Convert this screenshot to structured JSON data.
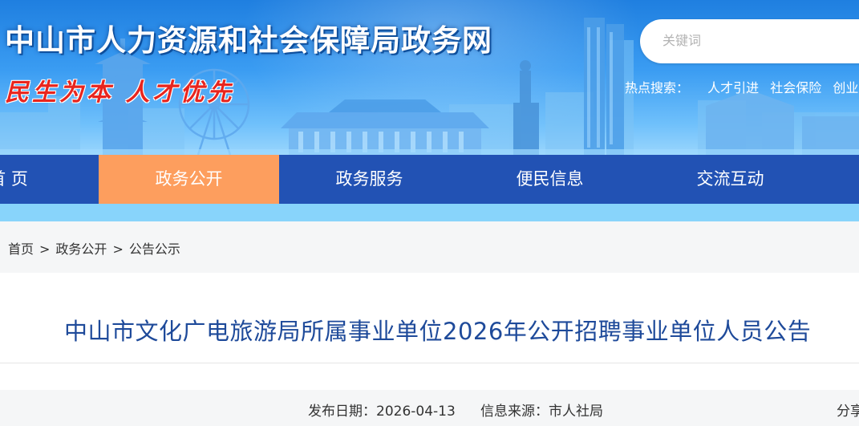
{
  "header": {
    "site_title": "中山市人力资源和社会保障局政务网",
    "slogan": "民生为本 人才优先",
    "search_placeholder": "关键词",
    "hot_label": "热点搜索：",
    "hot_links": [
      "人才引进",
      "社会保险",
      "创业"
    ]
  },
  "nav": {
    "items": [
      "首 页",
      "政务公开",
      "政务服务",
      "便民信息",
      "交流互动"
    ],
    "active_index": 1
  },
  "breadcrumb": [
    "首页",
    "政务公开",
    "公告公示"
  ],
  "breadcrumb_separator": ">",
  "article": {
    "title": "中山市文化广电旅游局所属事业单位2026年公开招聘事业单位人员公告",
    "publish_date_label": "发布日期：",
    "publish_date": "2026-04-13",
    "source_label": "信息来源：",
    "source": "市人社局",
    "share_label": "分享"
  },
  "colors": {
    "nav_bg": "#2252b4",
    "nav_active": "#fd9e5e",
    "title_blue": "#1e4a9a",
    "slogan_red": "#e8251e"
  }
}
